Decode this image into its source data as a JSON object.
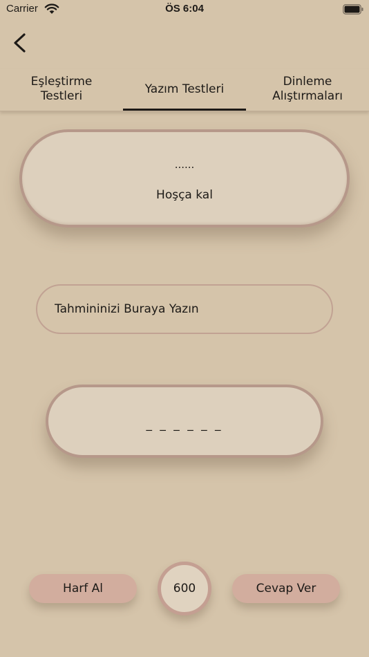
{
  "status_bar": {
    "carrier": "Carrier",
    "time": "ÖS 6:04"
  },
  "tabs": [
    {
      "label": "Eşleştirme\nTestleri",
      "selected": false
    },
    {
      "label": "Yazım Testleri",
      "selected": true
    },
    {
      "label": "Dinleme\nAlıştırmaları",
      "selected": false
    }
  ],
  "word_card": {
    "hint": "......",
    "word": "Hoşça kal"
  },
  "guess_input": {
    "placeholder": "Tahmininizi Buraya Yazın",
    "value": ""
  },
  "answer_card": {
    "blanks": "_ _ _ _ _ _"
  },
  "controls": {
    "letter_button": "Harf Al",
    "score": "600",
    "answer_button": "Cevap Ver"
  },
  "colors": {
    "background": "#d5c4aa",
    "card": "#ddd0bd",
    "card_border": "#b6988a",
    "button": "#d2ad9e"
  },
  "icons": [
    "wifi-icon",
    "battery-icon",
    "back-chevron-icon"
  ]
}
